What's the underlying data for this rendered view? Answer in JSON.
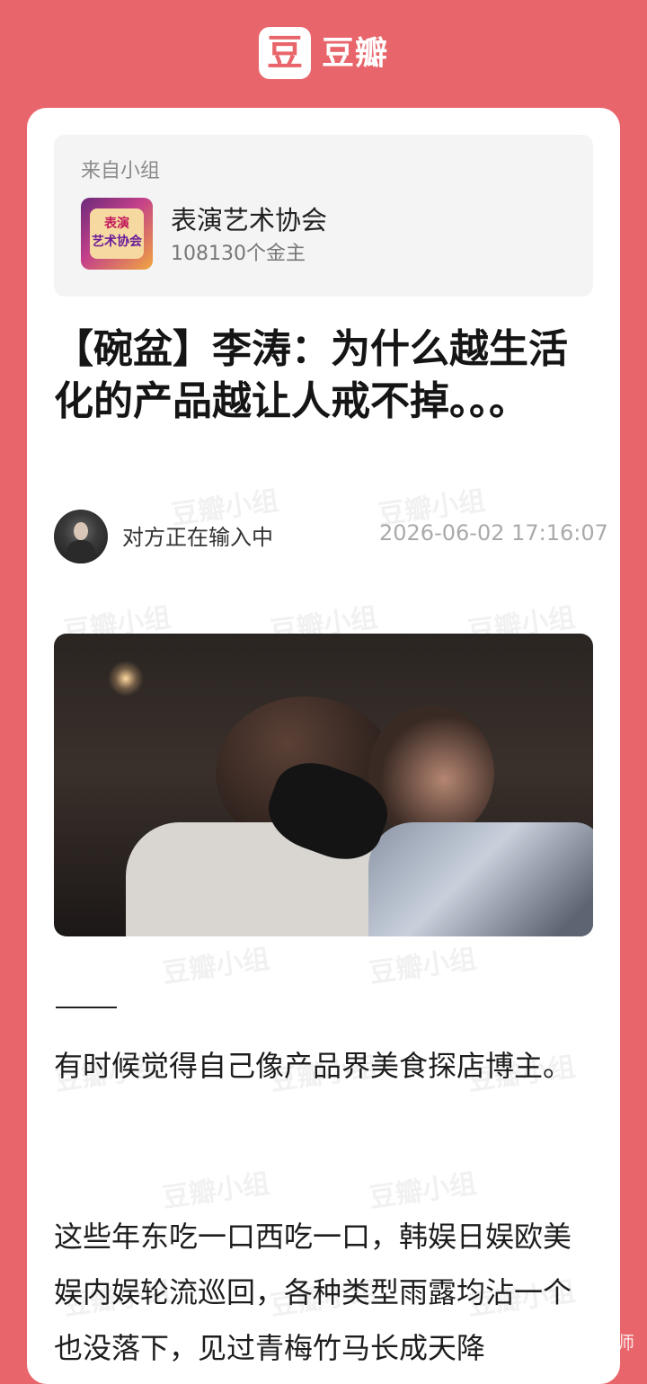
{
  "header": {
    "logo_glyph": "豆",
    "logo_text": "豆瓣",
    "brand_color": "#e8666b"
  },
  "group": {
    "from_label": "来自小组",
    "icon_text_1": "表演",
    "icon_text_2": "艺术协会",
    "name": "表演艺术协会",
    "members": "108130个金主"
  },
  "post": {
    "title": "【碗盆】李涛：为什么越生活化的产品越让人戒不掉。。。",
    "author": "对方正在输入中",
    "timestamp": "2026-06-02 17:16:07",
    "paragraphs": [
      "有时候觉得自己像产品界美食探店博主。",
      "这些年东吃一口西吃一口，韩娱日娱欧美娱内娱轮流巡回，各种类型雨露均沾一个也没落下，见过青梅竹马长成天降"
    ]
  },
  "watermark": "豆瓣小组",
  "credit": "@美药学鸟师"
}
